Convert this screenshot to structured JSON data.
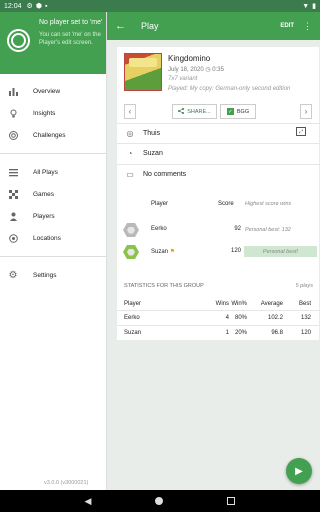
{
  "statusbar": {
    "time": "12:04"
  },
  "drawer": {
    "header_line1": "No player set to 'me'",
    "header_line2": "You can set 'me' on the Player's edit screen.",
    "items_top": [
      {
        "label": "Overview",
        "icon": "bar-chart-icon"
      },
      {
        "label": "Insights",
        "icon": "lightbulb-icon"
      },
      {
        "label": "Challenges",
        "icon": "target-icon"
      }
    ],
    "items_mid": [
      {
        "label": "All Plays",
        "icon": "list-icon"
      },
      {
        "label": "Games",
        "icon": "chessboard-icon"
      },
      {
        "label": "Players",
        "icon": "person-icon"
      },
      {
        "label": "Locations",
        "icon": "location-icon"
      }
    ],
    "items_bottom": [
      {
        "label": "Settings",
        "icon": "gear-icon"
      }
    ],
    "version": "v3.0.0 (v3000021)"
  },
  "appbar": {
    "title": "Play",
    "edit_label": "EDIT"
  },
  "play": {
    "game_name": "Kingdomino",
    "date": "July 18, 2020",
    "duration": "0:35",
    "variant": "7x7 variant",
    "played_with": "Played: My copy: German-only second edition",
    "share_label": "SHARE...",
    "bgg_label": "BGG",
    "location": "Thuis",
    "incomplete_player": "Suzan",
    "comments": "No comments"
  },
  "players_table": {
    "header": {
      "player": "Player",
      "score": "Score",
      "note": "Highest score wins"
    },
    "rows": [
      {
        "name": "Eerko",
        "score": "92",
        "note": "Personal best: 132",
        "winner": false
      },
      {
        "name": "Suzan",
        "score": "120",
        "note": "Personal best!",
        "winner": true
      }
    ]
  },
  "stats": {
    "title": "STATISTICS FOR THIS GROUP",
    "plays": "5 plays",
    "header": {
      "player": "Player",
      "wins": "Wins",
      "winpct": "Win%",
      "avg": "Average",
      "best": "Best"
    },
    "rows": [
      {
        "player": "Eerko",
        "wins": "4",
        "winpct": "80%",
        "avg": "102.2",
        "best": "132"
      },
      {
        "player": "Suzan",
        "wins": "1",
        "winpct": "20%",
        "avg": "96.8",
        "best": "120"
      }
    ]
  },
  "colors": {
    "accent": "#43a050",
    "statusbar": "#3a7c4c",
    "best_bg": "#cfe6d0"
  }
}
